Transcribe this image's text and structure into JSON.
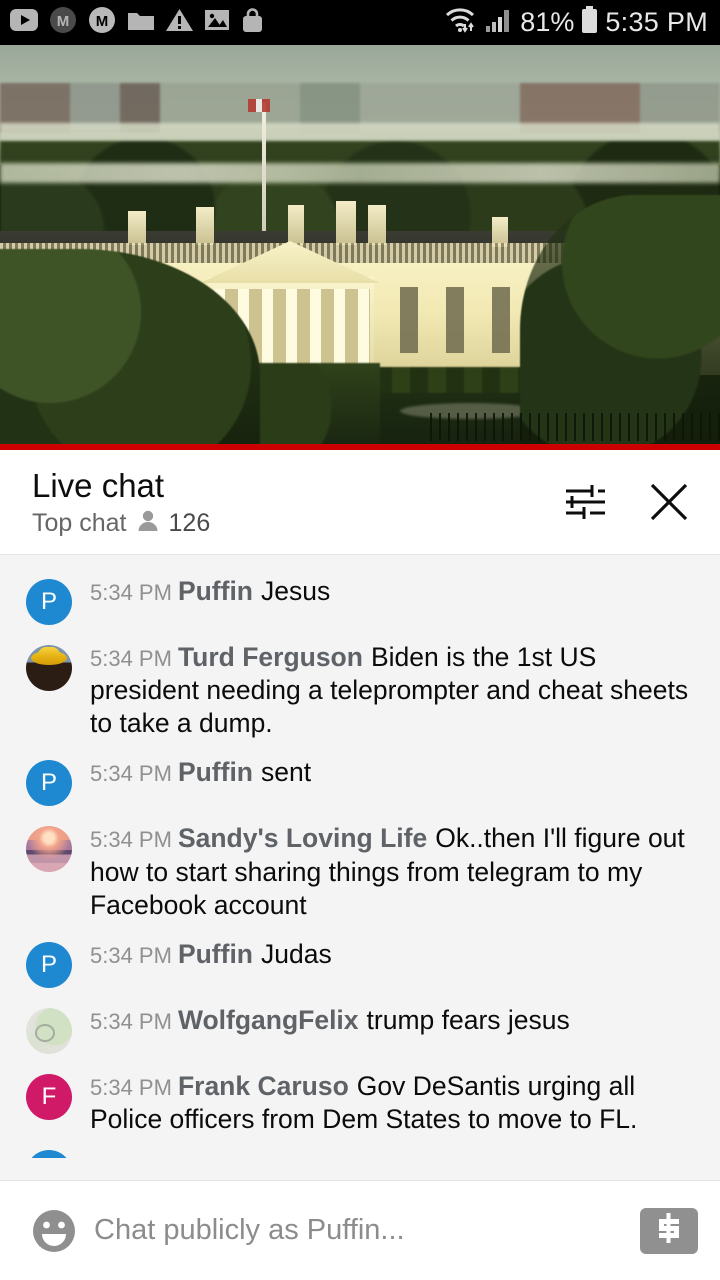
{
  "statusbar": {
    "icons": [
      "youtube-icon",
      "m-badge-icon",
      "m-circle-icon",
      "folder-icon",
      "warning-icon",
      "image-icon",
      "shopping-bag-icon"
    ],
    "wifi": "wifi-icon",
    "signal": "cellular-signal-icon",
    "battery_percent": "81%",
    "battery": "battery-icon",
    "time": "5:35 PM"
  },
  "video": {
    "description": "white-house-live-stream",
    "progress_color": "#cc0000"
  },
  "chat_header": {
    "title": "Live chat",
    "mode": "Top chat",
    "viewer_icon": "person-icon",
    "viewer_count": "126",
    "filter_icon": "chat-filter-icon",
    "close_icon": "close-icon"
  },
  "messages": [
    {
      "avatar_type": "letter",
      "avatar_letter": "P",
      "avatar_color": "#1e88d0",
      "time": "5:34 PM",
      "author": "Puffin",
      "text": "Jesus"
    },
    {
      "avatar_type": "photo-cowboy",
      "avatar_letter": "",
      "avatar_color": "#7f94ad",
      "time": "5:34 PM",
      "author": "Turd Ferguson",
      "text": "Biden is the 1st US president needing a teleprompter and cheat sheets to take a dump."
    },
    {
      "avatar_type": "letter",
      "avatar_letter": "P",
      "avatar_color": "#1e88d0",
      "time": "5:34 PM",
      "author": "Puffin",
      "text": "sent"
    },
    {
      "avatar_type": "photo-sunset",
      "avatar_letter": "",
      "avatar_color": "#d09a97",
      "time": "5:34 PM",
      "author": "Sandy's Loving Life",
      "text": "Ok..then I'll figure out how to start sharing things from telegram to my Facebook account"
    },
    {
      "avatar_type": "letter",
      "avatar_letter": "P",
      "avatar_color": "#1e88d0",
      "time": "5:34 PM",
      "author": "Puffin",
      "text": "Judas"
    },
    {
      "avatar_type": "photo-wolf",
      "avatar_letter": "",
      "avatar_color": "#dfe3d8",
      "time": "5:34 PM",
      "author": "WolfgangFelix",
      "text": "trump fears jesus"
    },
    {
      "avatar_type": "letter",
      "avatar_letter": "F",
      "avatar_color": "#d01a68",
      "time": "5:34 PM",
      "author": "Frank Caruso",
      "text": "Gov DeSantis urging all Police officers from Dem States to move to FL."
    }
  ],
  "input_bar": {
    "emoji_icon": "emoji-smiley-icon",
    "placeholder": "Chat publicly as Puffin...",
    "value": "",
    "superchat_icon": "dollar-sign-icon"
  }
}
